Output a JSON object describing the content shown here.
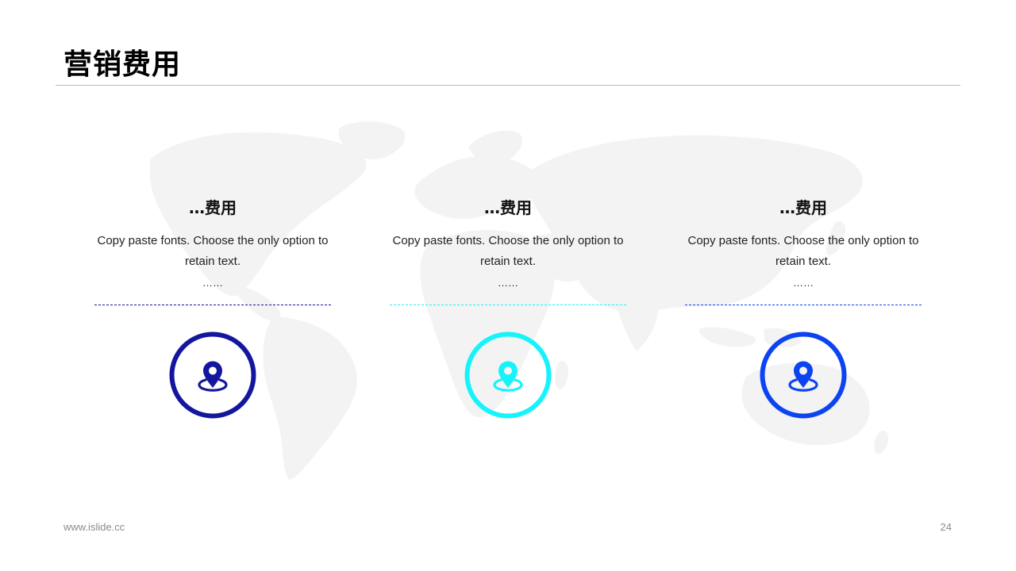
{
  "page": {
    "title": "营销费用",
    "footer_left": "www.islide.cc",
    "page_number": "24"
  },
  "cards": [
    {
      "heading": "…费用",
      "text": "Copy paste fonts. Choose the only option to retain text.",
      "dots": "……",
      "accent": "#14179e",
      "icon": "location-pin-icon"
    },
    {
      "heading": "…费用",
      "text": "Copy paste fonts. Choose the only option to retain text.",
      "dots": "……",
      "accent": "#17f3fb",
      "icon": "location-pin-icon"
    },
    {
      "heading": "…费用",
      "text": "Copy paste fonts. Choose the only option to retain text.",
      "dots": "……",
      "accent": "#0c44f2",
      "icon": "location-pin-icon"
    }
  ],
  "colors": {
    "map": "#f3f3f3",
    "divider": "#b8b8b8"
  }
}
